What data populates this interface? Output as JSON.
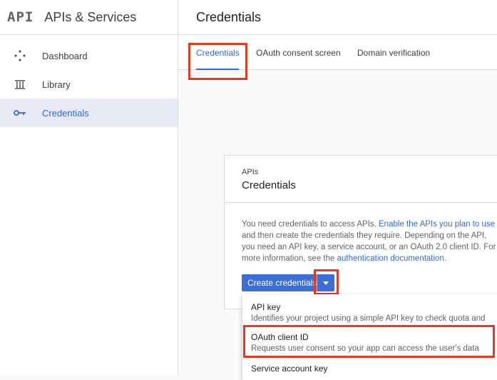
{
  "sidebar": {
    "logo": "API",
    "title": "APIs & Services",
    "items": [
      {
        "label": "Dashboard",
        "icon": "dashboard-icon",
        "active": false
      },
      {
        "label": "Library",
        "icon": "library-icon",
        "active": false
      },
      {
        "label": "Credentials",
        "icon": "key-icon",
        "active": true
      }
    ]
  },
  "header": {
    "title": "Credentials"
  },
  "tabs": [
    {
      "label": "Credentials",
      "active": true
    },
    {
      "label": "OAuth consent screen",
      "active": false
    },
    {
      "label": "Domain verification",
      "active": false
    }
  ],
  "card": {
    "kicker": "APIs",
    "title": "Credentials",
    "body": {
      "t1": "You need credentials to access APIs. ",
      "link1": "Enable the APIs you plan to use",
      "t2": " and then create the credentials they require. Depending on the API, you need an API key, a service account, or an OAuth 2.0 client ID. For more information, see the ",
      "link2": "authentication documentation",
      "t3": "."
    }
  },
  "create_button": {
    "label": "Create credentials"
  },
  "menu": {
    "items": [
      {
        "title": "API key",
        "desc": "Identifies your project using a simple API key to check quota and"
      },
      {
        "title": "OAuth client ID",
        "desc": "Requests user consent so your app can access the user's data"
      },
      {
        "title": "Service account key",
        "desc": ""
      }
    ]
  },
  "colors": {
    "accent": "#3367d6",
    "highlight": "#e53a21",
    "button": "#3b6fd6"
  }
}
